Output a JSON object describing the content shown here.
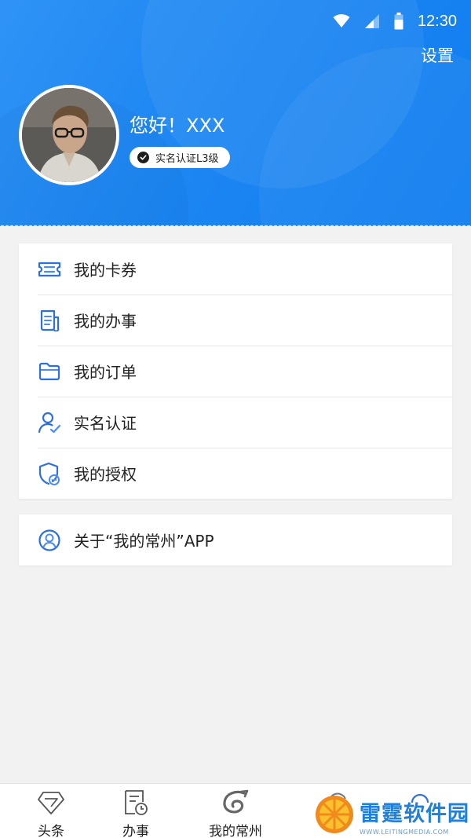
{
  "status_bar": {
    "time": "12:30"
  },
  "header": {
    "settings_label": "设置",
    "greeting": "您好！XXX",
    "badge_label": "实名认证L3级"
  },
  "menu": {
    "items": [
      {
        "label": "我的卡券",
        "icon": "ticket-icon"
      },
      {
        "label": "我的办事",
        "icon": "document-icon"
      },
      {
        "label": "我的订单",
        "icon": "folder-icon"
      },
      {
        "label": "实名认证",
        "icon": "user-check-icon"
      },
      {
        "label": "我的授权",
        "icon": "shield-icon"
      }
    ]
  },
  "about": {
    "label": "关于“我的常州”APP",
    "icon": "user-circle-icon"
  },
  "tabbar": {
    "items": [
      {
        "label": "头条",
        "icon": "diamond-icon"
      },
      {
        "label": "办事",
        "icon": "clipboard-clock-icon"
      },
      {
        "label": "我的常州",
        "icon": "swirl-logo-icon"
      }
    ]
  },
  "watermark": {
    "main": "雷霆软件园",
    "sub": "WWW.LEITINGMEDIA.COM"
  },
  "colors": {
    "primary": "#1d86f2",
    "icon_blue": "#2e6fe0",
    "background": "#f2f2f2"
  }
}
